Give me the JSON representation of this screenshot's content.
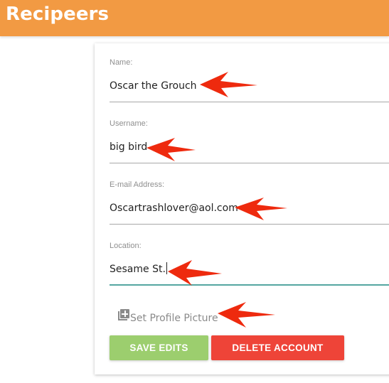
{
  "app": {
    "title": "Recipeers"
  },
  "form": {
    "fields": [
      {
        "label": "Name:",
        "value": "Oscar the Grouch"
      },
      {
        "label": "Username:",
        "value": "big bird"
      },
      {
        "label": "E-mail Address:",
        "value": "Oscartrashlover@aol.com"
      },
      {
        "label": "Location:",
        "value": "Sesame St."
      }
    ],
    "profile_picture_label": "Set Profile Picture",
    "save_label": "SAVE EDITS",
    "delete_label": "DELETE ACCOUNT"
  },
  "colors": {
    "header": "#f29a43",
    "save_button": "#9cce6e",
    "delete_button": "#ee4438",
    "active_underline": "#54a6a1",
    "annotation_arrow": "#ee2a0e"
  },
  "icons": {
    "profile_picture": "add-photo-icon",
    "annotation": "arrow-icon"
  }
}
